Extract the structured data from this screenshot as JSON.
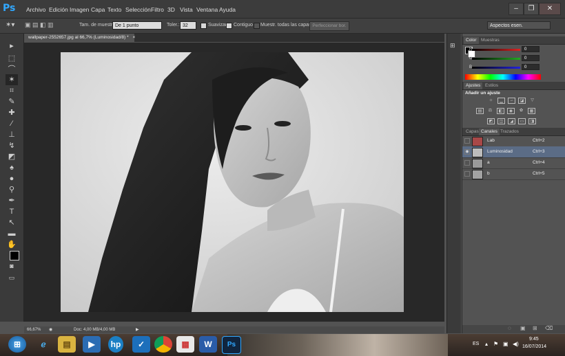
{
  "app": {
    "logo": "Ps"
  },
  "menu": [
    "Archivo",
    "Edición",
    "Imagen",
    "Capa",
    "Texto",
    "Selección",
    "Filtro",
    "3D",
    "Vista",
    "Ventana",
    "Ayuda"
  ],
  "window_controls": {
    "minimize": "–",
    "restore": "❐",
    "close": "✕"
  },
  "options": {
    "sample_size_label": "Tam. de muestra:",
    "sample_size_value": "De 1 punto",
    "tolerance_label": "Toler.:",
    "tolerance_value": "32",
    "antialias_label": "Suavizar",
    "contiguous_label": "Contiguo",
    "sample_all_label": "Muestr. todas las capas",
    "refine_edge_label": "Perfeccionar bor.",
    "workspace_value": "Aspectos esen."
  },
  "document": {
    "tab_title": "wallpaper-2552657.jpg al 66,7% (Luminosidad/8) *",
    "tab_close": "×",
    "zoom": "66,67%",
    "doc_info": "Doc: 4,00 MB/4,00 MB"
  },
  "color_panel": {
    "tabs": [
      "Color",
      "Muestras"
    ],
    "channels": [
      {
        "label": "R",
        "value": "0",
        "color": "#d22"
      },
      {
        "label": "G",
        "value": "0",
        "color": "#2a2"
      },
      {
        "label": "B",
        "value": "0",
        "color": "#22d"
      }
    ]
  },
  "adjustments_panel": {
    "tabs": [
      "Ajustes",
      "Estilos"
    ],
    "heading": "Añadir un ajuste"
  },
  "channels_panel": {
    "tabs": [
      "Capas",
      "Canales",
      "Trazados"
    ],
    "rows": [
      {
        "name": "Lab",
        "shortcut": "Ctrl+2",
        "thumb": "#a84848",
        "selected": false
      },
      {
        "name": "Luminosidad",
        "shortcut": "Ctrl+3",
        "thumb": "#bcbcbc",
        "selected": true
      },
      {
        "name": "a",
        "shortcut": "Ctrl+4",
        "thumb": "#9a9a9a",
        "selected": false
      },
      {
        "name": "b",
        "shortcut": "Ctrl+5",
        "thumb": "#a2a2a2",
        "selected": false
      }
    ]
  },
  "taskbar": {
    "lang": "ES",
    "time": "9:45",
    "date": "16/07/2014",
    "ps_label": "Ps"
  }
}
